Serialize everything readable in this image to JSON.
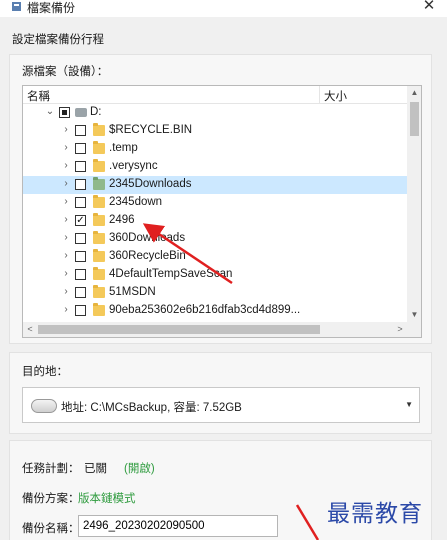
{
  "window": {
    "title": "檔案備份",
    "close_glyph": "✕"
  },
  "section_title": "設定檔案備份行程",
  "source": {
    "label": "源檔案（設備）：",
    "columns": [
      "名稱",
      "大小"
    ],
    "rows": [
      {
        "label": "D:",
        "type": "drive",
        "checked": "partial",
        "chevron": "⌄"
      },
      {
        "label": "$RECYCLE.BIN",
        "type": "folder",
        "checked": false,
        "chevron": "›"
      },
      {
        "label": ".temp",
        "type": "folder",
        "checked": false,
        "chevron": "›"
      },
      {
        "label": ".verysync",
        "type": "folder",
        "checked": false,
        "chevron": "›"
      },
      {
        "label": "2345Downloads",
        "type": "folder-green",
        "checked": false,
        "chevron": "›",
        "selected": true
      },
      {
        "label": "2345down",
        "type": "folder",
        "checked": false,
        "chevron": "›"
      },
      {
        "label": "2496",
        "type": "folder",
        "checked": true,
        "chevron": "›"
      },
      {
        "label": "360Downloads",
        "type": "folder",
        "checked": false,
        "chevron": "›"
      },
      {
        "label": "360RecycleBin",
        "type": "folder",
        "checked": false,
        "chevron": "›"
      },
      {
        "label": "4DefaultTempSaveScan",
        "type": "folder",
        "checked": false,
        "chevron": "›"
      },
      {
        "label": "51MSDN",
        "type": "folder",
        "checked": false,
        "chevron": "›"
      },
      {
        "label": "90eba253602e6b216dfab3cd4d899...",
        "type": "folder",
        "checked": false,
        "chevron": "›"
      }
    ],
    "scroll": {
      "up": "▲",
      "down": "▼",
      "left": "<",
      "right": ">"
    }
  },
  "destination": {
    "label": "目的地：",
    "value": "地址: C:\\MCsBackup, 容量: 7.52GB",
    "dropdown_arrow": "▼"
  },
  "schedule": {
    "label": "任務計劃：",
    "value": "已關",
    "toggle_link": "(開啟)",
    "plan_label": "備份方案：",
    "plan_link": "版本鏈模式",
    "name_label": "備份名稱：",
    "name_value": "2496_20230202090500"
  },
  "watermark": "最需教育",
  "colors": {
    "accent_green": "#2e9b3e",
    "selection": "#cce8ff",
    "annotation_red": "#e02020",
    "watermark": "#2b49a8"
  }
}
